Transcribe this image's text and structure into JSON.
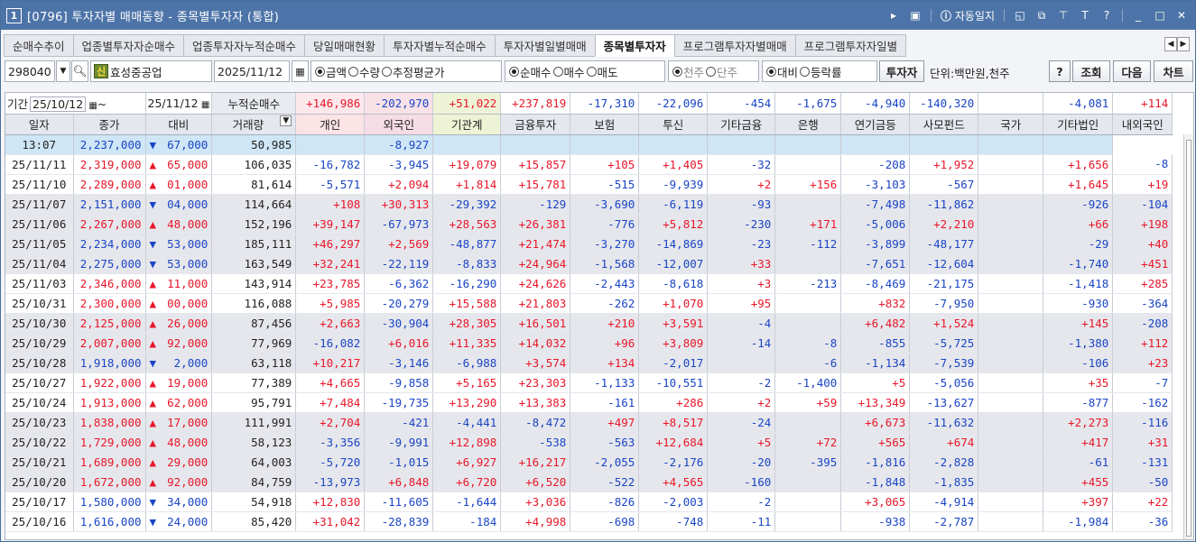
{
  "window": {
    "num": "1",
    "title": "[0796] 투자자별 매매동향 - 종목별투자자 (통합)",
    "auto_log": "자동일지"
  },
  "tabs": [
    "순매수추이",
    "업종별투자자순매수",
    "업종투자자누적순매수",
    "당일매매현황",
    "투자자별누적순매수",
    "투자자별일별매매",
    "종목별투자자",
    "프로그램투자자별매매",
    "프로그램투자자일별"
  ],
  "active_tab": 6,
  "toolbar": {
    "code": "298040",
    "sin": "신",
    "name": "효성중공업",
    "date": "2025/11/12",
    "radio1": [
      "금액",
      "수량",
      "추정평균가"
    ],
    "radio2": [
      "순매수",
      "매수",
      "매도"
    ],
    "radio3": [
      "천주",
      "단주"
    ],
    "radio4": [
      "대비",
      "등락률"
    ],
    "investor_btn": "투자자",
    "unit": "단위:백만원,천주",
    "help": "?",
    "query": "조회",
    "next": "다음",
    "chart": "차트"
  },
  "period": {
    "label": "기간",
    "from": "25/10/12",
    "to": "25/11/12",
    "cum": "누적순매수"
  },
  "summary": [
    "+146,986",
    "-202,970",
    "+51,022",
    "+237,819",
    "-17,310",
    "-22,096",
    "-454",
    "-1,675",
    "-4,940",
    "-140,320",
    "",
    "-4,081",
    "+114"
  ],
  "headers": [
    "일자",
    "종가",
    "대비",
    "거래량",
    "개인",
    "외국인",
    "기관계",
    "금융투자",
    "보험",
    "투신",
    "기타금융",
    "은행",
    "연기금등",
    "사모펀드",
    "국가",
    "기타법인",
    "내외국인"
  ],
  "rows": [
    [
      "13:07",
      "2,237,000",
      "▼",
      "67,000",
      "50,985",
      "",
      "-8,927",
      "",
      "",
      "",
      "",
      "",
      "",
      "",
      "",
      "",
      ""
    ],
    [
      "25/11/11",
      "2,319,000",
      "▲",
      "65,000",
      "106,035",
      "-16,782",
      "-3,945",
      "+19,079",
      "+15,857",
      "+105",
      "+1,405",
      "-32",
      "",
      "-208",
      "+1,952",
      "",
      "+1,656",
      "-8"
    ],
    [
      "25/11/10",
      "2,289,000",
      "▲",
      "01,000",
      "81,614",
      "-5,571",
      "+2,094",
      "+1,814",
      "+15,781",
      "-515",
      "-9,939",
      "+2",
      "+156",
      "-3,103",
      "-567",
      "",
      "+1,645",
      "+19"
    ],
    [
      "25/11/07",
      "2,151,000",
      "▼",
      "04,000",
      "114,664",
      "+108",
      "+30,313",
      "-29,392",
      "-129",
      "-3,690",
      "-6,119",
      "-93",
      "",
      "-7,498",
      "-11,862",
      "",
      "-926",
      "-104"
    ],
    [
      "25/11/06",
      "2,267,000",
      "▲",
      "48,000",
      "152,196",
      "+39,147",
      "-67,973",
      "+28,563",
      "+26,381",
      "-776",
      "+5,812",
      "-230",
      "+171",
      "-5,006",
      "+2,210",
      "",
      "+66",
      "+198"
    ],
    [
      "25/11/05",
      "2,234,000",
      "▼",
      "53,000",
      "185,111",
      "+46,297",
      "+2,569",
      "-48,877",
      "+21,474",
      "-3,270",
      "-14,869",
      "-23",
      "-112",
      "-3,899",
      "-48,177",
      "",
      "-29",
      "+40"
    ],
    [
      "25/11/04",
      "2,275,000",
      "▼",
      "53,000",
      "163,549",
      "+32,241",
      "-22,119",
      "-8,833",
      "+24,964",
      "-1,568",
      "-12,007",
      "+33",
      "",
      "-7,651",
      "-12,604",
      "",
      "-1,740",
      "+451"
    ],
    [
      "25/11/03",
      "2,346,000",
      "▲",
      "11,000",
      "143,914",
      "+23,785",
      "-6,362",
      "-16,290",
      "+24,626",
      "-2,443",
      "-8,618",
      "+3",
      "-213",
      "-8,469",
      "-21,175",
      "",
      "-1,418",
      "+285"
    ],
    [
      "25/10/31",
      "2,300,000",
      "▲",
      "00,000",
      "116,088",
      "+5,985",
      "-20,279",
      "+15,588",
      "+21,803",
      "-262",
      "+1,070",
      "+95",
      "",
      "+832",
      "-7,950",
      "",
      "-930",
      "-364"
    ],
    [
      "25/10/30",
      "2,125,000",
      "▲",
      "26,000",
      "87,456",
      "+2,663",
      "-30,904",
      "+28,305",
      "+16,501",
      "+210",
      "+3,591",
      "-4",
      "",
      "+6,482",
      "+1,524",
      "",
      "+145",
      "-208"
    ],
    [
      "25/10/29",
      "2,007,000",
      "▲",
      "92,000",
      "77,969",
      "-16,082",
      "+6,016",
      "+11,335",
      "+14,032",
      "+96",
      "+3,809",
      "-14",
      "-8",
      "-855",
      "-5,725",
      "",
      "-1,380",
      "+112"
    ],
    [
      "25/10/28",
      "1,918,000",
      "▼",
      "2,000",
      "63,118",
      "+10,217",
      "-3,146",
      "-6,988",
      "+3,574",
      "+134",
      "-2,017",
      "",
      "-6",
      "-1,134",
      "-7,539",
      "",
      "-106",
      "+23"
    ],
    [
      "25/10/27",
      "1,922,000",
      "▲",
      "19,000",
      "77,389",
      "+4,665",
      "-9,858",
      "+5,165",
      "+23,303",
      "-1,133",
      "-10,551",
      "-2",
      "-1,400",
      "+5",
      "-5,056",
      "",
      "+35",
      "-7"
    ],
    [
      "25/10/24",
      "1,913,000",
      "▲",
      "62,000",
      "95,791",
      "+7,484",
      "-19,735",
      "+13,290",
      "+13,383",
      "-161",
      "+286",
      "+2",
      "+59",
      "+13,349",
      "-13,627",
      "",
      "-877",
      "-162"
    ],
    [
      "25/10/23",
      "1,838,000",
      "▲",
      "17,000",
      "111,991",
      "+2,704",
      "-421",
      "-4,441",
      "-8,472",
      "+497",
      "+8,517",
      "-24",
      "",
      "+6,673",
      "-11,632",
      "",
      "+2,273",
      "-116"
    ],
    [
      "25/10/22",
      "1,729,000",
      "▲",
      "48,000",
      "58,123",
      "-3,356",
      "-9,991",
      "+12,898",
      "-538",
      "-563",
      "+12,684",
      "+5",
      "+72",
      "+565",
      "+674",
      "",
      "+417",
      "+31"
    ],
    [
      "25/10/21",
      "1,689,000",
      "▲",
      "29,000",
      "64,003",
      "-5,720",
      "-1,015",
      "+6,927",
      "+16,217",
      "-2,055",
      "-2,176",
      "-20",
      "-395",
      "-1,816",
      "-2,828",
      "",
      "-61",
      "-131"
    ],
    [
      "25/10/20",
      "1,672,000",
      "▲",
      "92,000",
      "84,759",
      "-13,973",
      "+6,848",
      "+6,720",
      "+6,520",
      "-522",
      "+4,565",
      "-160",
      "",
      "-1,848",
      "-1,835",
      "",
      "+455",
      "-50"
    ],
    [
      "25/10/17",
      "1,580,000",
      "▼",
      "34,000",
      "54,918",
      "+12,830",
      "-11,605",
      "-1,644",
      "+3,036",
      "-826",
      "-2,003",
      "-2",
      "",
      "+3,065",
      "-4,914",
      "",
      "+397",
      "+22"
    ],
    [
      "25/10/16",
      "1,616,000",
      "▼",
      "24,000",
      "85,420",
      "+31,042",
      "-28,839",
      "-184",
      "+4,998",
      "-698",
      "-748",
      "-11",
      "",
      "-938",
      "-2,787",
      "",
      "-1,984",
      "-36"
    ]
  ],
  "colors": {
    "title": "#4d74a8",
    "pos": "#e8172a",
    "neg": "#1a45c6",
    "hdr_personal": "#fbe3e6",
    "hdr_foreign": "#f6dce4",
    "hdr_inst": "#eef3d5"
  }
}
